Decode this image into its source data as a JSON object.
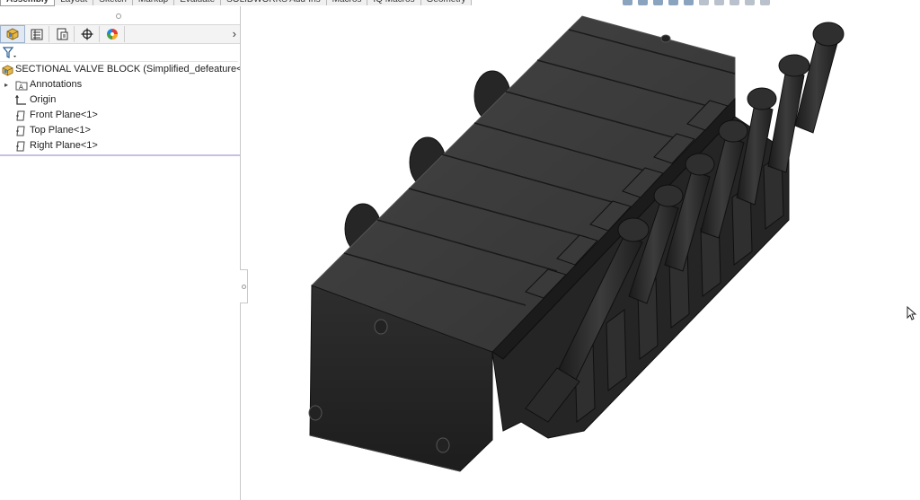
{
  "command_tabs": [
    "Assembly",
    "Layout",
    "Sketch",
    "Markup",
    "Evaluate",
    "SOLIDWORKS Add-Ins",
    "Macros",
    "IQ Macros",
    "Geometry"
  ],
  "panel_tabs": [
    {
      "name": "feature-manager-tab",
      "icon": "assembly-cube-icon"
    },
    {
      "name": "property-manager-tab",
      "icon": "property-list-icon"
    },
    {
      "name": "configuration-manager-tab",
      "icon": "configuration-icon"
    },
    {
      "name": "dimxpert-manager-tab",
      "icon": "crosshair-icon"
    },
    {
      "name": "display-manager-tab",
      "icon": "color-wheel-icon"
    }
  ],
  "tree": {
    "root": "SECTIONAL VALVE BLOCK  (Simplified_defeature<Dis",
    "items": [
      {
        "label": "Annotations",
        "icon": "annotations-folder-icon",
        "expandable": true
      },
      {
        "label": "Origin",
        "icon": "origin-icon",
        "expandable": false
      },
      {
        "label": "Front Plane<1>",
        "icon": "plane-icon",
        "expandable": false
      },
      {
        "label": "Top Plane<1>",
        "icon": "plane-icon",
        "expandable": false
      },
      {
        "label": "Right Plane<1>",
        "icon": "plane-icon",
        "expandable": false
      }
    ]
  },
  "colors": {
    "model_dark": "#2b2b2b",
    "model_face_top": "#3a3a3a",
    "model_face_side": "#1f1f1f",
    "selection_line": "#c8c0e0",
    "active_tab": "#dfe8f3"
  }
}
